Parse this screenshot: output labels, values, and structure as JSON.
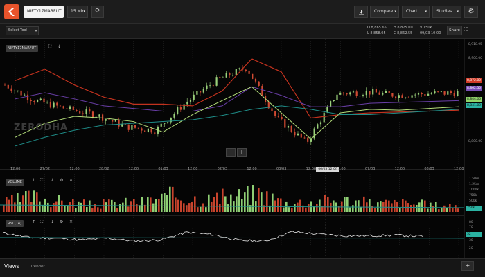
{
  "header": {
    "symbol": "NIFTY17MARFUT",
    "interval": "15 Min",
    "compare": "Compare",
    "chart": "Chart",
    "studies": "Studies"
  },
  "subbar": {
    "select_tool": "Select Tool",
    "ohlc": {
      "o_label": "O",
      "o": "8,865.65",
      "h_label": "H",
      "h": "8,875.00",
      "vol_label": "V",
      "vol": "150k",
      "l_label": "L",
      "l": "8,858.05",
      "c_label": "C",
      "c": "8,862.55",
      "date": "09/03 10:00"
    },
    "share": "Share"
  },
  "main_chart": {
    "label": "NIFTY17MARFUT",
    "watermark": "ZERODHA",
    "zoom_out": "−",
    "zoom_in": "+",
    "y_ticks": [
      "8,918.95",
      "8,900.00",
      "8,850.00",
      "8,800.00"
    ],
    "price_tags": [
      {
        "text": "8,872.00",
        "color": "#d13b27"
      },
      {
        "text": "8,862.55",
        "color": "#7a4fb8"
      },
      {
        "text": "8,844.05",
        "color": "#8fd46a"
      },
      {
        "text": "8,841.00",
        "color": "#2bb3a3"
      }
    ],
    "x_labels": [
      "12:00",
      "27/02",
      "12:00",
      "28/02",
      "12:00",
      "01/03",
      "12:00",
      "02/03",
      "12:00",
      "03/03",
      "12:00",
      "12:00",
      "07/03",
      "12:00",
      "08/03",
      "12:00"
    ],
    "hover_x": "06/03 12:00"
  },
  "volume_panel": {
    "label": "VOLUME",
    "y_ticks": [
      "1.50m",
      "1.25m",
      "1000k",
      "750k",
      "500k",
      "250k"
    ],
    "tag": "250k"
  },
  "rsi_panel": {
    "label": "RSI (14)",
    "y_ticks": [
      "80",
      "70",
      "50",
      "30",
      "20"
    ],
    "tag": "52"
  },
  "footer": {
    "views": "Views",
    "tab": "Trender",
    "plus": "+"
  },
  "chart_data": {
    "type": "line",
    "x": [
      "12:00",
      "27/02",
      "12:00",
      "28/02",
      "12:00",
      "01/03",
      "12:00",
      "02/03",
      "12:00",
      "03/03",
      "12:00",
      "12:00",
      "07/03",
      "12:00",
      "08/03",
      "12:00"
    ],
    "series": [
      {
        "values": [
          8880,
          8862,
          8853,
          8846,
          8832,
          8828,
          8860,
          8885,
          8900,
          8842,
          8814,
          8870,
          8872,
          8868,
          8870,
          8871
        ]
      },
      {
        "values": [
          8885,
          8898,
          8880,
          8866,
          8858,
          8858,
          8856,
          8873,
          8910,
          8895,
          8842,
          8846,
          8848,
          8849,
          8850,
          8851
        ]
      },
      {
        "values": [
          8864,
          8871,
          8864,
          8856,
          8853,
          8850,
          8850,
          8856,
          8878,
          8868,
          8855,
          8855,
          8859,
          8860,
          8861,
          8862
        ]
      },
      {
        "values": [
          8820,
          8836,
          8844,
          8842,
          8838,
          8826,
          8846,
          8862,
          8878,
          8848,
          8818,
          8848,
          8852,
          8851,
          8853,
          8855
        ]
      },
      {
        "values": [
          8810,
          8820,
          8828,
          8834,
          8836,
          8838,
          8840,
          8845,
          8852,
          8856,
          8852,
          8846,
          8846,
          8848,
          8850,
          8852
        ]
      }
    ],
    "colors": [
      "#e6e6e6",
      "#c3321e",
      "#6a3fa8",
      "#b6e07c",
      "#1f8f8a"
    ],
    "volume": [
      520,
      900,
      640,
      430,
      520,
      620,
      980,
      740,
      880,
      1100,
      520,
      640,
      690,
      520,
      520,
      430,
      350
    ],
    "rsi": [
      58,
      50,
      49,
      46,
      49,
      44,
      46,
      59,
      55,
      45,
      44,
      60,
      56,
      53,
      53,
      54,
      52
    ],
    "ylim": [
      8790,
      8925
    ],
    "grid": true
  }
}
